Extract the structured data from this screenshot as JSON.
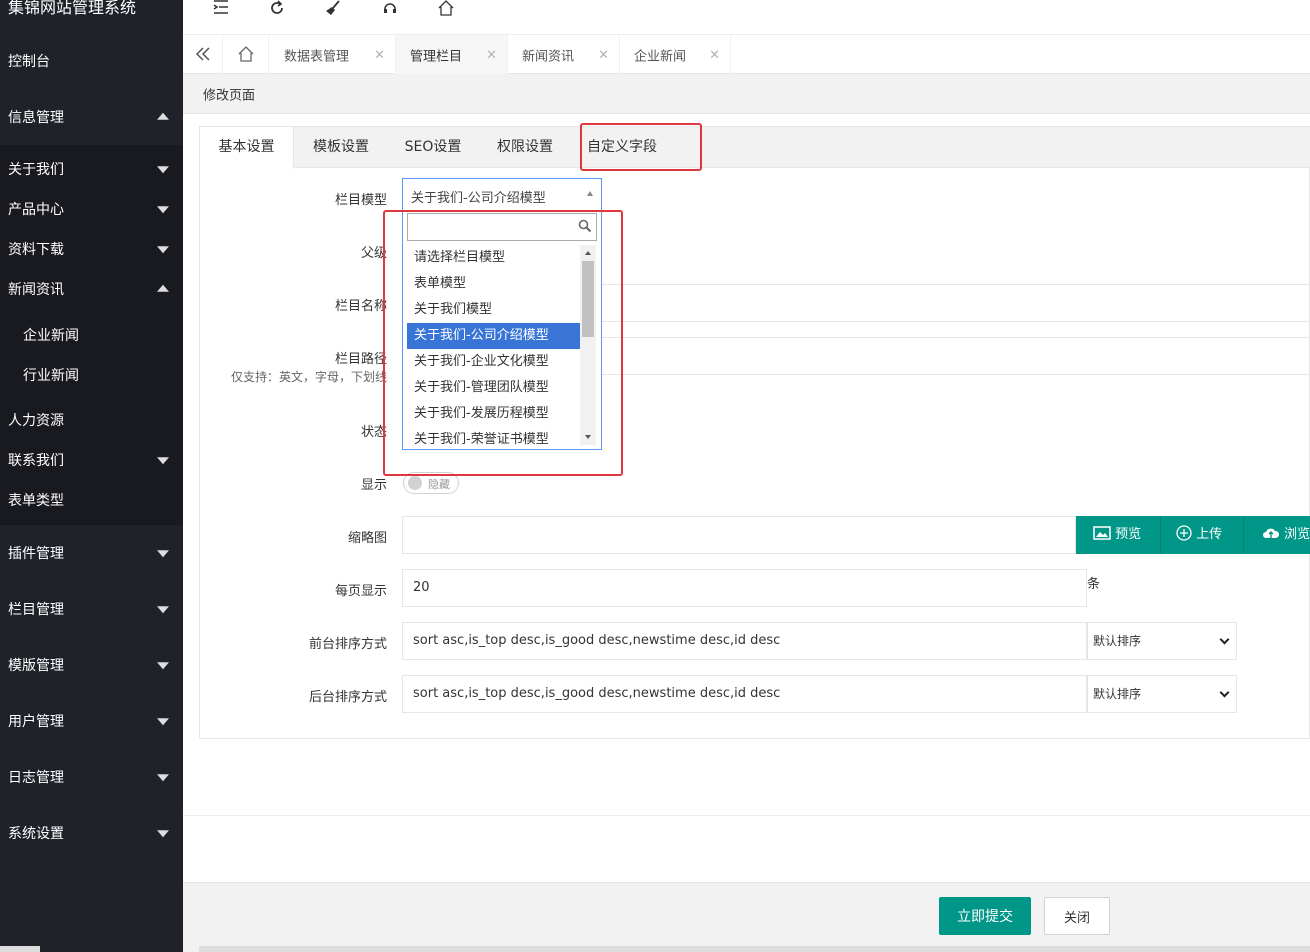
{
  "sidebar": {
    "title": "集锦网站管理系统",
    "console": "控制台",
    "info_mgmt": "信息管理",
    "sub_items": [
      "关于我们",
      "产品中心",
      "资料下载",
      "新闻资讯",
      "企业新闻",
      "行业新闻",
      "人力资源",
      "联系我们",
      "表单类型"
    ],
    "bottom_items": [
      "插件管理",
      "栏目管理",
      "模版管理",
      "用户管理",
      "日志管理",
      "系统设置"
    ]
  },
  "toolbar": {
    "icons": [
      "menu-fold-icon",
      "refresh-icon",
      "broom-icon",
      "service-icon",
      "home-icon"
    ]
  },
  "tabs": {
    "home_icon": "home-icon",
    "items": [
      {
        "label": "数据表管理",
        "close": "×"
      },
      {
        "label": "管理栏目",
        "close": "×"
      },
      {
        "label": "新闻资讯",
        "close": "×"
      },
      {
        "label": "企业新闻",
        "close": "×"
      }
    ]
  },
  "page": {
    "head": "修改页面",
    "card_tabs": [
      "基本设置",
      "模板设置",
      "SEO设置",
      "权限设置",
      "自定义字段"
    ]
  },
  "form": {
    "model_label": "栏目模型",
    "model_value": "关于我们-公司介绍模型",
    "parent_label": "父级",
    "name_label": "栏目名称",
    "path_label": "栏目路径",
    "path_hint": "仅支持：英文，字母，下划线",
    "status_label": "状态",
    "show_label": "显示",
    "show_switch": "隐藏",
    "thumb_label": "缩略图",
    "thumb_btns": [
      "预览",
      "上传",
      "浏览"
    ],
    "per_page_label": "每页显示",
    "per_page_value": "20",
    "per_page_unit": "条",
    "front_sort_label": "前台排序方式",
    "front_sort_value": "sort asc,is_top desc,is_good desc,newstime desc,id desc",
    "front_sort_select": "默认排序",
    "back_sort_label": "后台排序方式",
    "back_sort_value": "sort asc,is_top desc,is_good desc,newstime desc,id desc",
    "back_sort_select": "默认排序"
  },
  "dropdown": {
    "options": [
      "请选择栏目模型",
      "表单模型",
      "关于我们模型",
      "关于我们-公司介绍模型",
      "关于我们-企业文化模型",
      "关于我们-管理团队模型",
      "关于我们-发展历程模型",
      "关于我们-荣誉证书模型"
    ],
    "selected_index": 3
  },
  "footer": {
    "submit": "立即提交",
    "close": "关闭"
  },
  "colors": {
    "sidebar_bg": "#20222a",
    "accent": "#009688",
    "highlight": "#3875d7",
    "annotation_red": "#e0363d"
  }
}
